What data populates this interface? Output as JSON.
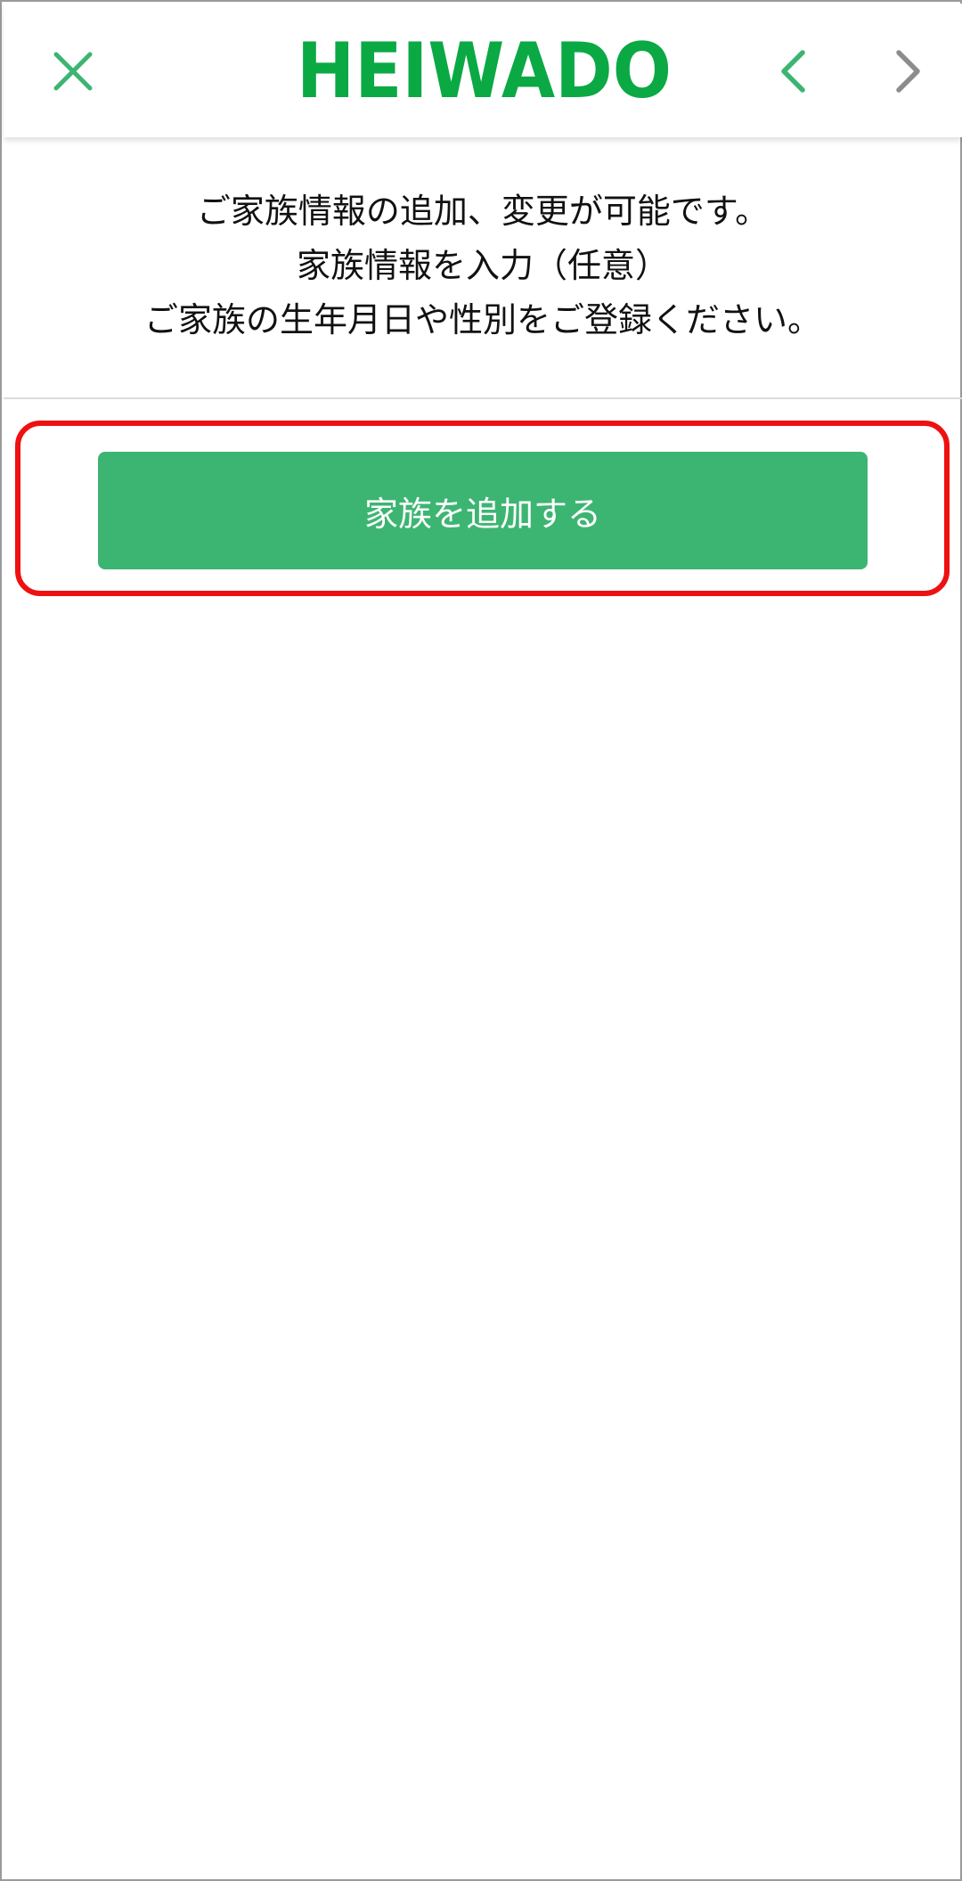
{
  "header": {
    "logo_text": "HEIWADO",
    "close_icon": "close-icon",
    "back_icon": "chevron-left-icon",
    "forward_icon": "chevron-right-icon"
  },
  "info": {
    "line1": "ご家族情報の追加、変更が可能です。",
    "line2": "家族情報を入力（任意）",
    "line3": "ご家族の生年月日や性別をご登録ください。"
  },
  "actions": {
    "add_family_label": "家族を追加する"
  },
  "colors": {
    "brand_green": "#0aa944",
    "button_green": "#3db572",
    "icon_green": "#3db572",
    "icon_gray": "#8c8c8c",
    "highlight_red": "#ee1111"
  }
}
